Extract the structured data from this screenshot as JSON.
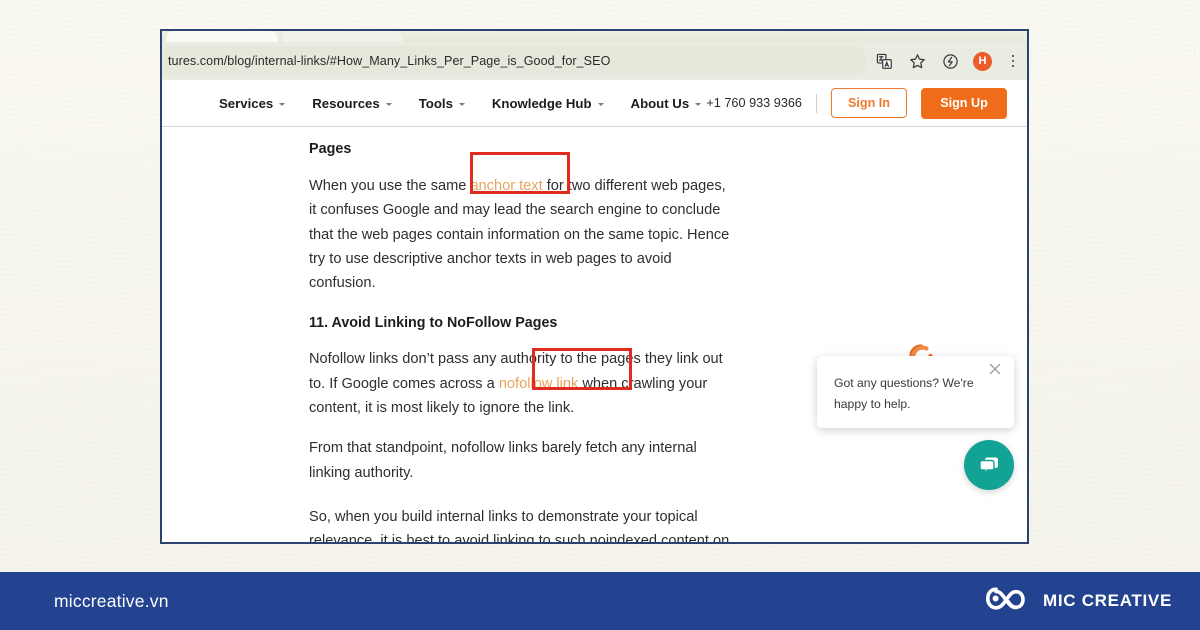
{
  "browser": {
    "url": "tures.com/blog/internal-links/#How_Many_Links_Per_Page_is_Good_for_SEO",
    "icons": {
      "translate": "translate-icon",
      "bookmark": "bookmark-star-icon",
      "extension": "extension-icon",
      "profile_initial": "H",
      "menu": "kebab-menu-icon"
    }
  },
  "site_nav": {
    "items": [
      {
        "label": "Services",
        "has_caret": true
      },
      {
        "label": "Resources",
        "has_caret": true
      },
      {
        "label": "Tools",
        "has_caret": true
      },
      {
        "label": "Knowledge Hub",
        "has_caret": true
      },
      {
        "label": "About Us",
        "has_caret": true
      }
    ],
    "phone": "+1 760 933 9366",
    "sign_in": "Sign In",
    "sign_up": "Sign Up"
  },
  "article": {
    "heading_partial": "Pages",
    "para1_before": "When you use the same ",
    "para1_link": "anchor text",
    "para1_after": " for two different web pages, it confuses Google and may lead the search engine to conclude that the web pages contain information on the same topic. Hence try to use descriptive anchor texts in web pages to avoid confusion.",
    "heading2": "11. Avoid Linking to NoFollow Pages",
    "para2_before": "Nofollow links don’t pass any authority to the pages they link out to. If Google comes across a ",
    "para2_link": "nofollow link",
    "para2_after": " when crawling your content, it is most likely to ignore the link.",
    "para3": "From that standpoint, nofollow links barely fetch any internal linking authority.",
    "para4": "So, when you build internal links to demonstrate your topical relevance, it is best to avoid linking to such noindexed content on your website."
  },
  "chat_widget": {
    "message": "Got any questions? We're happy to help.",
    "close_label": "×",
    "fab_icon": "chat-bubble-icon",
    "spinner_icon": "loading-spinner-icon"
  },
  "brand_bar": {
    "url": "miccreative.vn",
    "name": "MIC CREATIVE",
    "logo_icon": "mic-creative-infinity-logo"
  },
  "colors": {
    "brand_blue": "#234391",
    "accent_orange": "#ef6c1a",
    "link_orange": "#e8a45c",
    "highlight_red": "#e02b20",
    "chat_teal": "#12a394"
  }
}
